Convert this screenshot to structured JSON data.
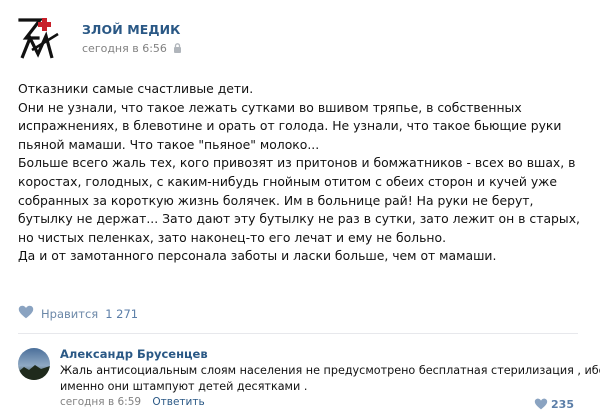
{
  "post": {
    "author": "ЗЛОЙ МЕДИК",
    "date": "сегодня в 6:56",
    "lines": [
      "Отказники самые счастливые дети.",
      "Они не узнали, что такое лежать сутками во вшивом тряпье, в собственных",
      "испражнениях, в блевотине и орать от голода. Не узнали, что такое бьющие руки",
      "пьяной мамаши. Что такое \"пьяное\" молоко...",
      "Больше всего жаль тех, кого привозят из притонов и бомжатников - всех во вшах, в",
      "коростах, голодных, с каким-нибудь гнойным отитом с обеих сторон и кучей уже",
      "собранных за короткую жизнь болячек. Им в больнице рай! На руки не берут,",
      "бутылку не держат... Зато дают эту бутылку не раз в сутки, зато лежит он в старых,",
      "но чистых пеленках, зато наконец-то его лечат и ему не больно.",
      "Да и от замотанного персонала заботы и ласки больше, чем от мамаши."
    ],
    "like_label": "Нравится",
    "like_count": "1 271"
  },
  "comment": {
    "author": "Александр Брусенцев",
    "lines": [
      "Жаль антисоциальным слоям населения не предусмотрено бесплатная стерилизация , ибо",
      "именно они штампуют детей десятками ."
    ],
    "date": "сегодня в 6:59",
    "reply_label": "Ответить",
    "like_count": "235"
  },
  "icons": {
    "logo": "zm-logo-icon",
    "privacy": "lock-icon",
    "like": "heart-icon",
    "comment_like": "heart-icon"
  },
  "colors": {
    "link": "#2a5885",
    "muted": "#828282",
    "like": "#6c88a8",
    "logo_red": "#c8202a"
  }
}
